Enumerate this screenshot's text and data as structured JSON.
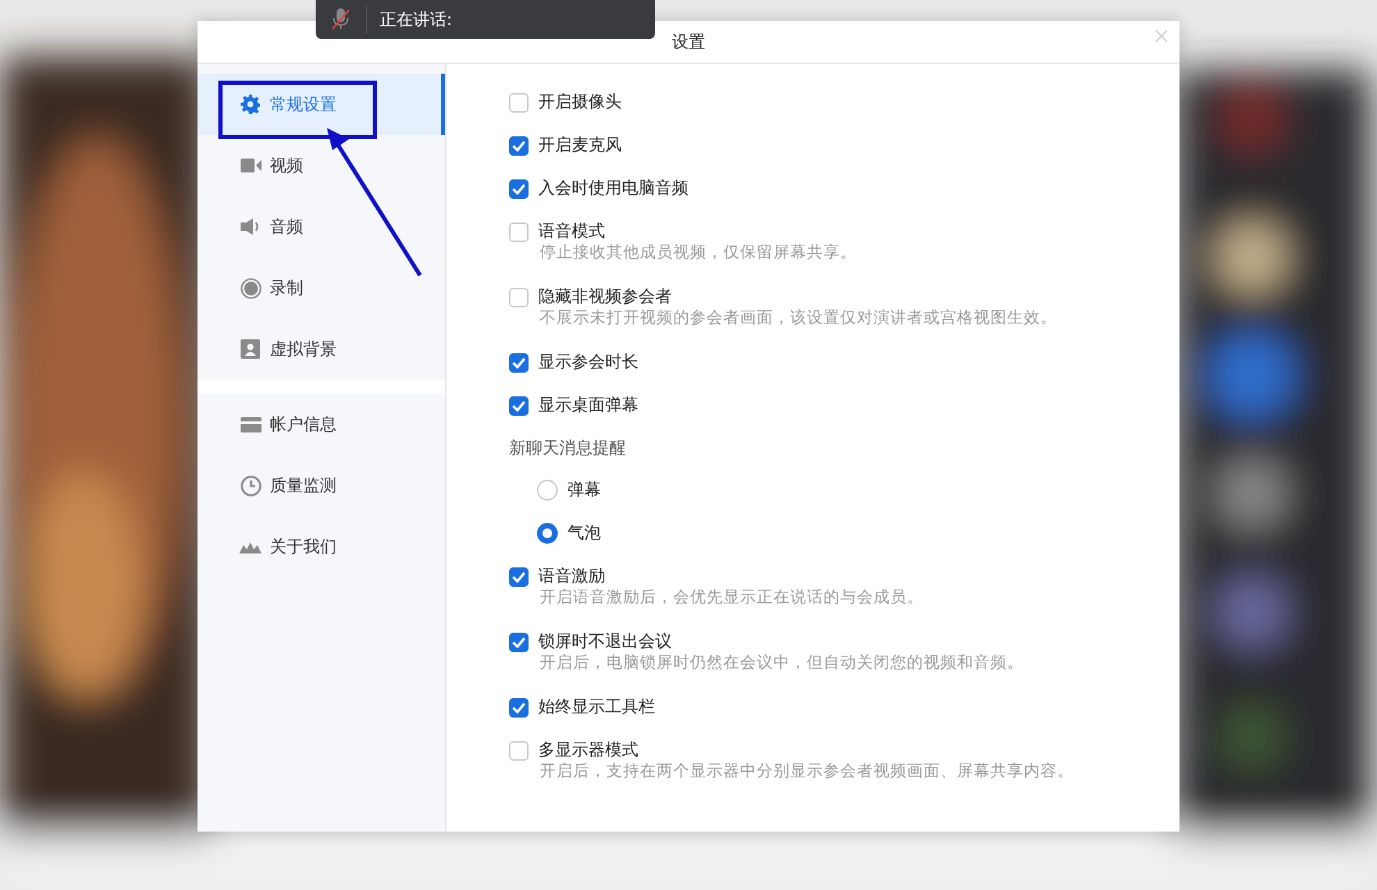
{
  "speaker_bar": {
    "label": "正在讲话:"
  },
  "dialog": {
    "title": "设置"
  },
  "sidebar": {
    "groups": [
      {
        "items": [
          {
            "label": "常规设置",
            "selected": true
          },
          {
            "label": "视频",
            "selected": false
          },
          {
            "label": "音频",
            "selected": false
          },
          {
            "label": "录制",
            "selected": false
          },
          {
            "label": "虚拟背景",
            "selected": false
          }
        ]
      },
      {
        "items": [
          {
            "label": "帐户信息",
            "selected": false
          },
          {
            "label": "质量监测",
            "selected": false
          },
          {
            "label": "关于我们",
            "selected": false
          }
        ]
      }
    ]
  },
  "settings": [
    {
      "kind": "checkbox",
      "label": "开启摄像头",
      "checked": false
    },
    {
      "kind": "checkbox",
      "label": "开启麦克风",
      "checked": true
    },
    {
      "kind": "checkbox",
      "label": "入会时使用电脑音频",
      "checked": true
    },
    {
      "kind": "checkbox",
      "label": "语音模式",
      "checked": false,
      "description": "停止接收其他成员视频，仅保留屏幕共享。"
    },
    {
      "kind": "checkbox",
      "label": "隐藏非视频参会者",
      "checked": false,
      "description": "不展示未打开视频的参会者画面，该设置仅对演讲者或宫格视图生效。"
    },
    {
      "kind": "checkbox",
      "label": "显示参会时长",
      "checked": true
    },
    {
      "kind": "checkbox",
      "label": "显示桌面弹幕",
      "checked": true
    },
    {
      "kind": "group_label",
      "label": "新聊天消息提醒"
    },
    {
      "kind": "radio",
      "label": "弹幕",
      "selected": false
    },
    {
      "kind": "radio",
      "label": "气泡",
      "selected": true
    },
    {
      "kind": "checkbox",
      "label": "语音激励",
      "checked": true,
      "description": "开启语音激励后，会优先显示正在说话的与会成员。"
    },
    {
      "kind": "checkbox",
      "label": "锁屏时不退出会议",
      "checked": true,
      "description": "开启后，电脑锁屏时仍然在会议中，但自动关闭您的视频和音频。"
    },
    {
      "kind": "checkbox",
      "label": "始终显示工具栏",
      "checked": true
    },
    {
      "kind": "checkbox",
      "label": "多显示器模式",
      "checked": false,
      "description": "开启后，支持在两个显示器中分别显示参会者视频画面、屏幕共享内容。"
    }
  ]
}
